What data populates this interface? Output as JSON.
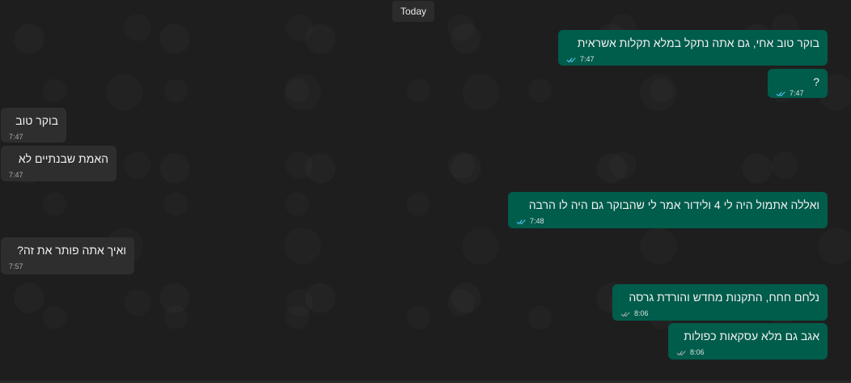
{
  "date_divider": "Today",
  "messages": [
    {
      "dir": "out",
      "text": "בוקר טוב אחי, גם אתה נתקל במלא תקלות אשראית",
      "time": "7:47",
      "read": true
    },
    {
      "dir": "out",
      "text": "?",
      "time": "7:47",
      "read": true
    },
    {
      "dir": "in",
      "text": "בוקר טוב",
      "time": "7:47"
    },
    {
      "dir": "in",
      "text": "האמת שבנתיים לא",
      "time": "7:47"
    },
    {
      "dir": "out",
      "text": "ואללה אתמול היה לי 4 ולידור אמר לי שהבוקר גם היה לו הרבה",
      "time": "7:48",
      "read": true
    },
    {
      "dir": "in",
      "text": "ואיך אתה פותר את זה?",
      "time": "7:57"
    },
    {
      "dir": "out",
      "text": "נלחם חחח, התקנות מחדש והורדת גרסה",
      "time": "8:06",
      "read": false
    },
    {
      "dir": "out",
      "text": "אגב גם מלא עסקאות כפולות",
      "time": "8:06",
      "read": false
    }
  ],
  "colors": {
    "outgoing": "#005c4b",
    "incoming": "#2e2e2e",
    "read_tick": "#53bdeb",
    "sent_tick": "#9aa7a4"
  }
}
